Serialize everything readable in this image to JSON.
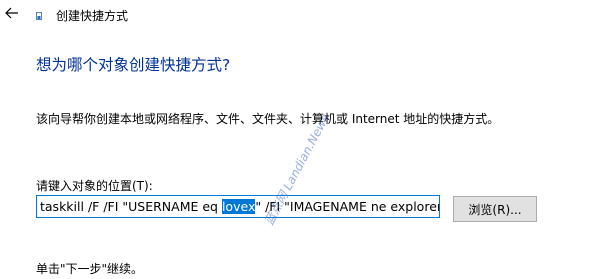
{
  "window": {
    "back_icon": "arrow-left-icon",
    "app_icon": "shortcut-icon",
    "title": "创建快捷方式"
  },
  "page": {
    "heading": "想为哪个对象创建快捷方式?",
    "description": "该向导帮你创建本地或网络程序、文件、文件夹、计算机或 Internet 地址的快捷方式。",
    "location_label": "请键入对象的位置(T):",
    "location_value_before": "taskkill /F /FI \"USERNAME eq ",
    "location_value_selected": "lovex",
    "location_value_after": "\" /FI \"IMAGENAME ne explorer.ex",
    "browse_label": "浏览(R)...",
    "footer": "单击\"下一步\"继续。"
  },
  "watermark": {
    "text": "蓝点网 Landian.News",
    "color": "#466ec8"
  },
  "colors": {
    "accent": "#0078d7",
    "heading": "#003399"
  }
}
